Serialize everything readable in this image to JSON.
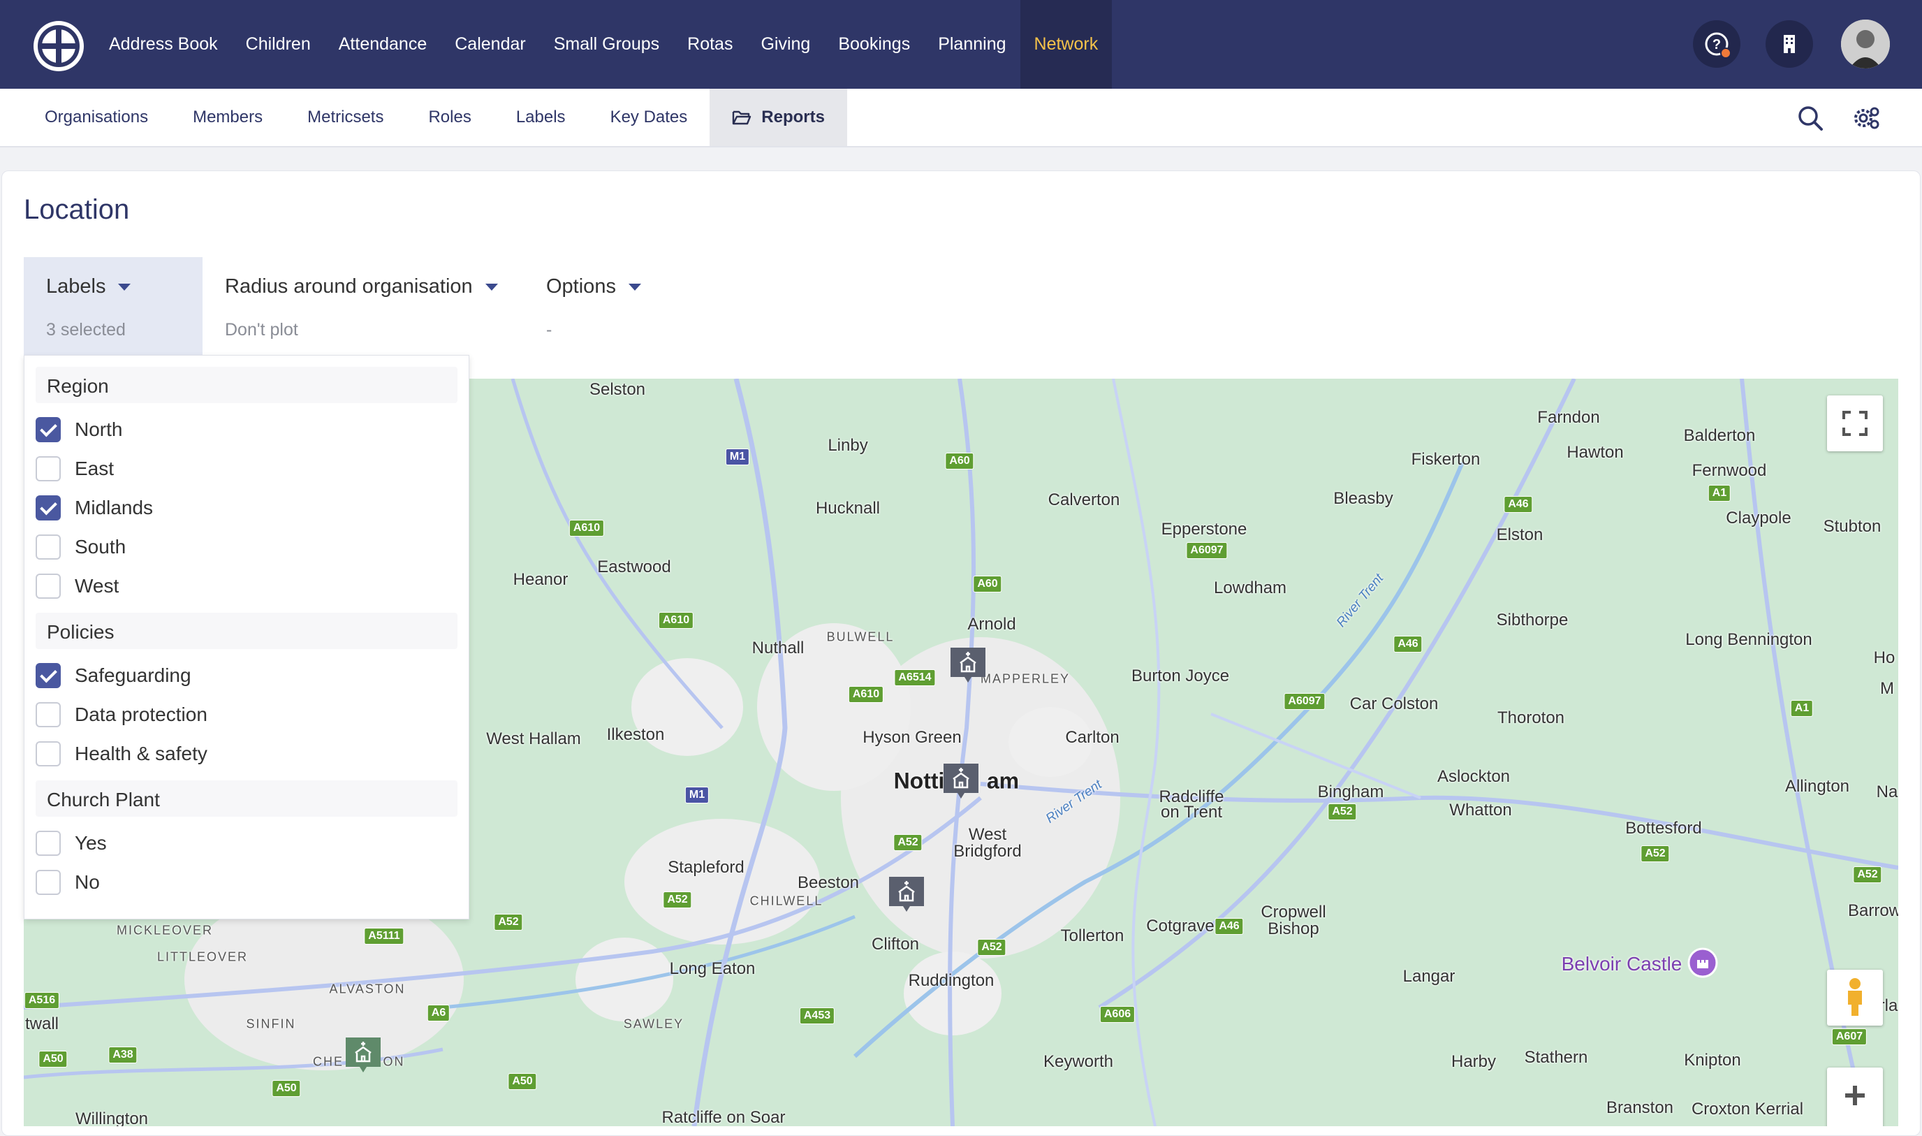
{
  "topnav": {
    "items": [
      "Address Book",
      "Children",
      "Attendance",
      "Calendar",
      "Small Groups",
      "Rotas",
      "Giving",
      "Bookings",
      "Planning",
      "Network"
    ],
    "active": "Network"
  },
  "subnav": {
    "items": [
      "Organisations",
      "Members",
      "Metricsets",
      "Roles",
      "Labels",
      "Key Dates",
      "Reports"
    ],
    "active": "Reports"
  },
  "page": {
    "title": "Location"
  },
  "filters": [
    {
      "label": "Labels",
      "summary": "3 selected"
    },
    {
      "label": "Radius around organisation",
      "summary": "Don't plot"
    },
    {
      "label": "Options",
      "summary": "-"
    }
  ],
  "dropdown": {
    "groups": [
      {
        "name": "Region",
        "options": [
          {
            "label": "North",
            "checked": true
          },
          {
            "label": "East",
            "checked": false
          },
          {
            "label": "Midlands",
            "checked": true
          },
          {
            "label": "South",
            "checked": false
          },
          {
            "label": "West",
            "checked": false
          }
        ]
      },
      {
        "name": "Policies",
        "options": [
          {
            "label": "Safeguarding",
            "checked": true
          },
          {
            "label": "Data protection",
            "checked": false
          },
          {
            "label": "Health & safety",
            "checked": false
          }
        ]
      },
      {
        "name": "Church Plant",
        "options": [
          {
            "label": "Yes",
            "checked": false
          },
          {
            "label": "No",
            "checked": false
          }
        ]
      }
    ]
  },
  "map": {
    "places": [
      "Selston",
      "Linby",
      "Hucknall",
      "Calverton",
      "Farndon",
      "Balderton",
      "Fiskerton",
      "Hawton",
      "Fernwood",
      "Bleasby",
      "Claypole",
      "Stubton",
      "Epperstone",
      "Elston",
      "Eastwood",
      "Heanor",
      "Lowdham",
      "Arnold",
      "BULWELL",
      "Nuthall",
      "MAPPERLEY",
      "Burton Joyce",
      "Sibthorpe",
      "Long Bennington",
      "Car Colston",
      "Thoroton",
      "Ilkeston",
      "West Hallam",
      "Hyson Green",
      "Carlton",
      "Notti",
      "am",
      "Aslockton",
      "Allington",
      "Bingham",
      "Radcliffe on Trent",
      "Whatton",
      "Bottesford",
      "West Bridgford",
      "Stapleford",
      "Beeston",
      "CHILWELL",
      "Cropwell Bishop",
      "Cotgrave",
      "Tollerton",
      "Clifton",
      "MICKLEOVER",
      "LITTLEOVER",
      "Long Eaton",
      "Ruddington",
      "Langar",
      "Belvoir Castle",
      "ALVASTON",
      "SINFIN",
      "SAWLEY",
      "CHE",
      "ON",
      "Keyworth",
      "Harby",
      "Stathern",
      "Knipton",
      "Willington",
      "Ratcliffe on Soar",
      "Branston",
      "Croxton Kerrial",
      "twall",
      "Ho",
      "M",
      "Na",
      "Barrow",
      "rla",
      "River Trent"
    ],
    "roads": [
      "M1",
      "A60",
      "A610",
      "A46",
      "A1",
      "A6097",
      "A60",
      "A610",
      "A46",
      "A6514",
      "A610",
      "A6097",
      "A1",
      "M1",
      "A52",
      "A52",
      "A52",
      "A52",
      "A52",
      "A52",
      "A52",
      "A46",
      "A5111",
      "A516",
      "A6",
      "A453",
      "A606",
      "A607",
      "A50",
      "A38",
      "A50",
      "A50"
    ],
    "poi": "Belvoir Castle"
  },
  "colors": {
    "topbar": "#2f3667",
    "active_nav": "#f5c24a",
    "accent": "#4a58a0",
    "map_bg": "#d5ebdc"
  }
}
